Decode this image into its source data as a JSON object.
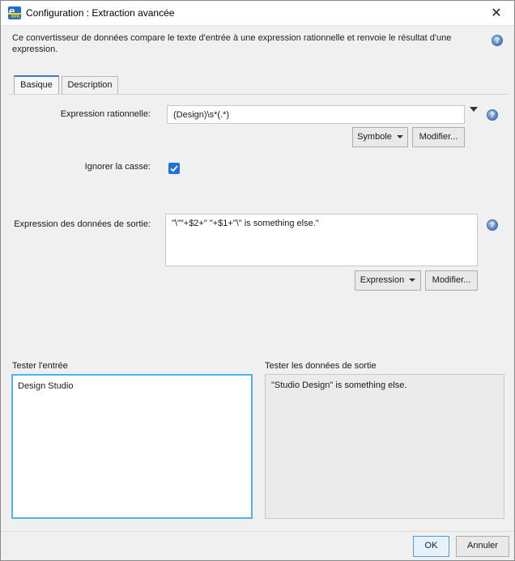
{
  "window": {
    "title": "Configuration : Extraction avancée",
    "close_glyph": "✕",
    "app_icon": "app-logo-icon"
  },
  "description": "Ce convertisseur de données compare le texte d'entrée à une expression rationnelle et renvoie le résultat d'une expression.",
  "tabs": [
    {
      "label": "Basique",
      "active": true
    },
    {
      "label": "Description",
      "active": false
    }
  ],
  "regex": {
    "label": "Expression rationnelle:",
    "value": "(Design)\\s*(.*)",
    "symbol_button": "Symbole",
    "modify_button": "Modifier..."
  },
  "ignore_case": {
    "label": "Ignorer la casse:",
    "checked": true
  },
  "output_expression": {
    "label": "Expression des données de sortie:",
    "value": "\"\\\"\"+$2+\" \"+$1+\"\\\" is something else.\"",
    "expression_button": "Expression",
    "modify_button": "Modifier..."
  },
  "test_input": {
    "label": "Tester l'entrée",
    "value": "Design Studio"
  },
  "test_output": {
    "label": "Tester les données de sortie",
    "value": "\"Studio Design\" is something else."
  },
  "footer": {
    "ok": "OK",
    "cancel": "Annuler"
  },
  "colors": {
    "accent": "#1f73d8",
    "focus_border": "#4fb3e6",
    "tab_accent": "#3b78c6"
  }
}
